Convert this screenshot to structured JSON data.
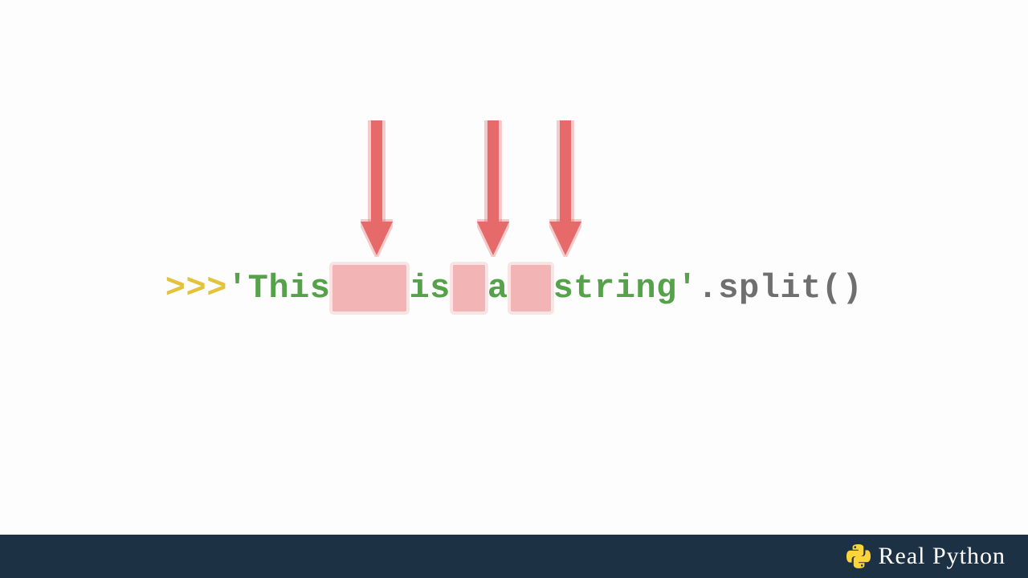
{
  "code": {
    "prompt": ">>>",
    "quote": "'",
    "words": [
      "This",
      "is",
      "a",
      "string"
    ],
    "dot": ".",
    "method": "split",
    "parens": "()"
  },
  "arrows": {
    "color": "#e66a6a",
    "shadow": "rgba(230,106,106,0.35)"
  },
  "footer": {
    "brand": "Real Python"
  }
}
